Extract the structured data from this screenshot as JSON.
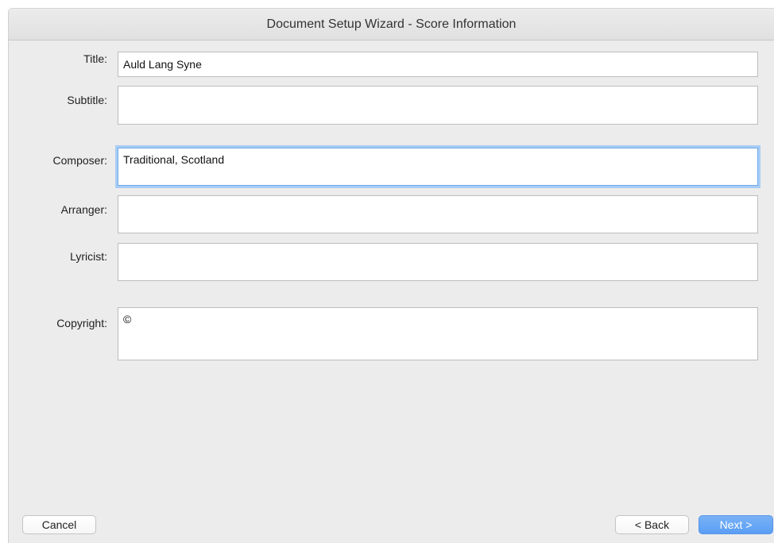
{
  "window": {
    "title": "Document Setup Wizard - Score Information"
  },
  "fields": {
    "title": {
      "label": "Title:",
      "value": "Auld Lang Syne"
    },
    "subtitle": {
      "label": "Subtitle:",
      "value": ""
    },
    "composer": {
      "label": "Composer:",
      "value": "Traditional, Scotland"
    },
    "arranger": {
      "label": "Arranger:",
      "value": ""
    },
    "lyricist": {
      "label": "Lyricist:",
      "value": ""
    },
    "copyright": {
      "label": "Copyright:",
      "value": "©"
    }
  },
  "buttons": {
    "cancel": "Cancel",
    "back": "< Back",
    "next": "Next >"
  },
  "colors": {
    "accent": "#5a9ef4",
    "focus_ring": "#a8cdf5",
    "window_bg": "#ececec"
  }
}
